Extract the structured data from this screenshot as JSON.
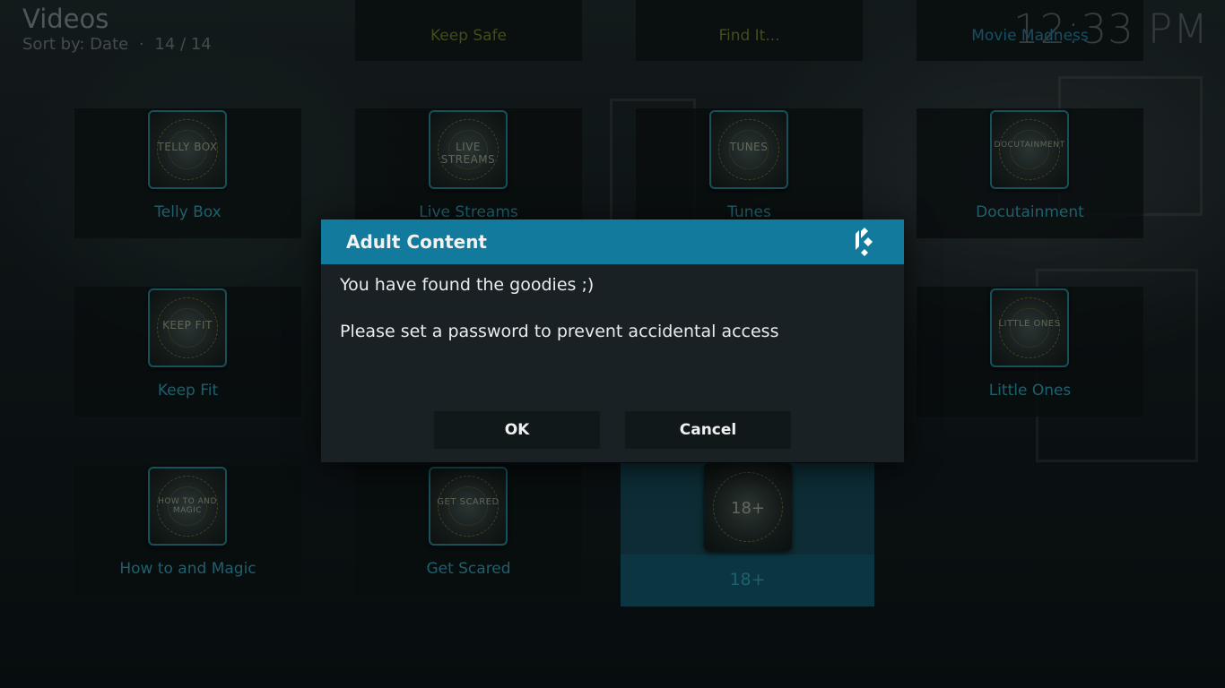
{
  "header": {
    "title": "Videos",
    "sort_label": "Sort by: Date",
    "separator": "·",
    "count": "14 / 14",
    "clock": "12:33 PM"
  },
  "top_row": [
    {
      "label": "Keep Safe"
    },
    {
      "label": "Find It..."
    },
    {
      "label": "Movie Madness"
    }
  ],
  "tiles": [
    {
      "label": "Telly Box",
      "thumb_text": "TELLY BOX"
    },
    {
      "label": "Live Streams",
      "thumb_text": "LIVE STREAMS"
    },
    {
      "label": "Tunes",
      "thumb_text": "TUNES"
    },
    {
      "label": "Docutainment",
      "thumb_text": "DOCUTAINMENT"
    },
    {
      "label": "Keep Fit",
      "thumb_text": "KEEP FIT"
    },
    {
      "label": "Little Ones",
      "thumb_text": "LITTLE ONES"
    },
    {
      "label": "How to and Magic",
      "thumb_text": "HOW TO AND MAGIC"
    },
    {
      "label": "Get Scared",
      "thumb_text": "GET SCARED"
    }
  ],
  "selected_tile": {
    "label": "18+",
    "thumb_text": "18+"
  },
  "dialog": {
    "title": "Adult Content",
    "line1": "You have found the goodies ;)",
    "line2": "Please set a password to prevent accidental access",
    "ok_label": "OK",
    "cancel_label": "Cancel",
    "icon": "kodi-logo-icon"
  },
  "colors": {
    "accent": "#127a9c",
    "tile_label": "#2a8598",
    "dialog_bg": "#1a2124"
  }
}
